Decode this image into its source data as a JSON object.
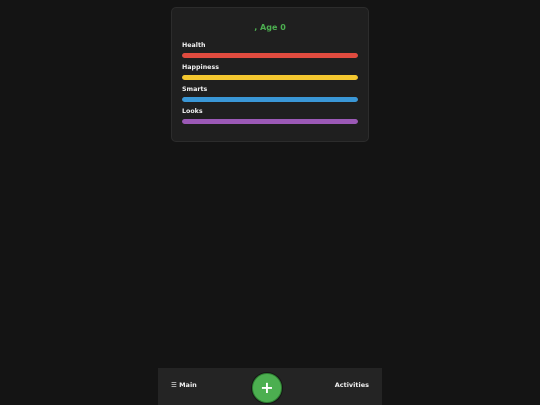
{
  "character": {
    "title": ", Age 0"
  },
  "stats": [
    {
      "label": "Health",
      "value": 100,
      "color": "#e04b3f"
    },
    {
      "label": "Happiness",
      "value": 100,
      "color": "#f4c72f"
    },
    {
      "label": "Smarts",
      "value": 100,
      "color": "#3a97d6"
    },
    {
      "label": "Looks",
      "value": 100,
      "color": "#9b59b6"
    }
  ],
  "nav": {
    "main_label": "☰ Main",
    "age_button_label": "+",
    "activities_label": "Activities"
  },
  "colors": {
    "accent": "#4caf50",
    "background": "#141414",
    "card": "#1f1f1f"
  }
}
